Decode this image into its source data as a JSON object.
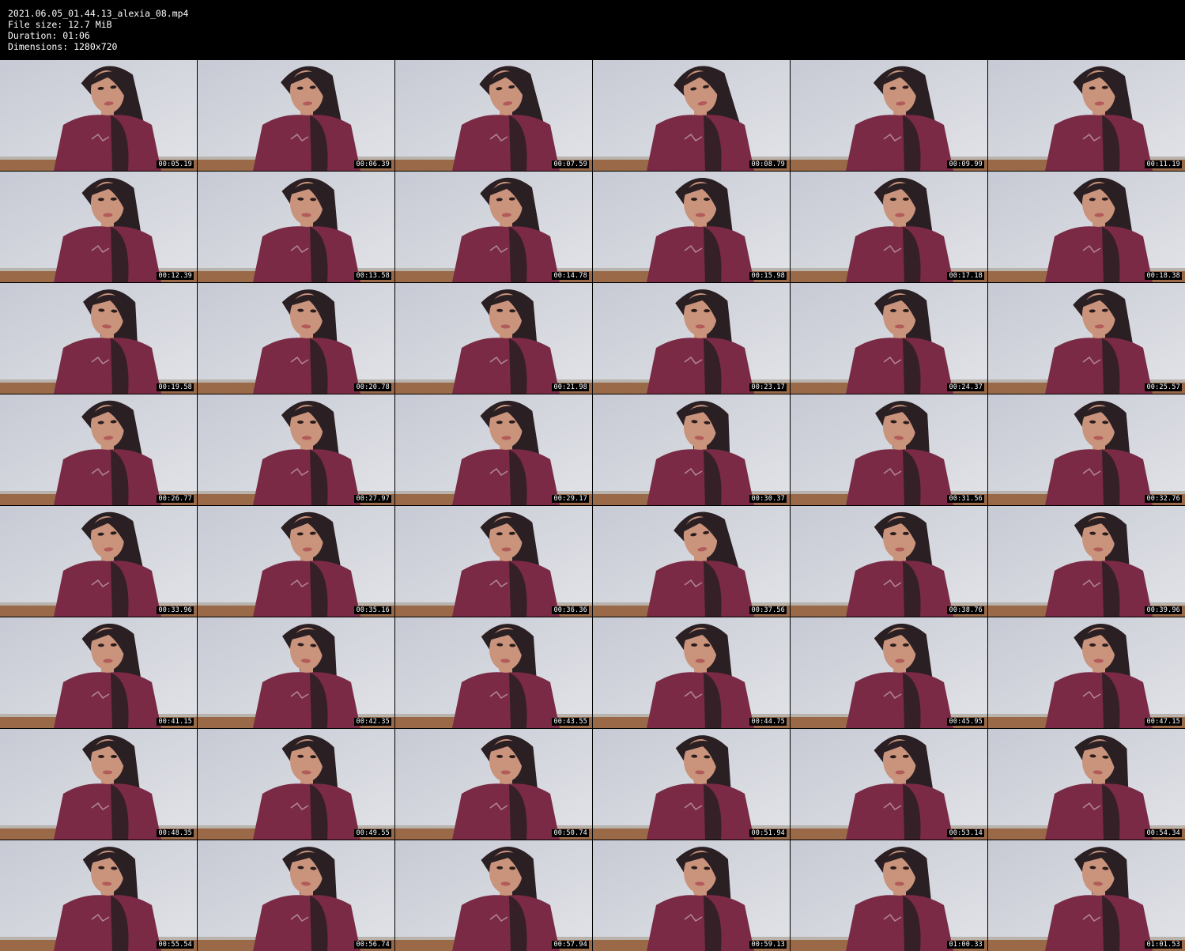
{
  "file_info": {
    "filename": "2021.06.05_01.44.13_alexia_08.mp4",
    "file_size": "File size: 12.7 MiB",
    "duration": "Duration: 01:06",
    "dimensions": "Dimensions: 1280x720"
  },
  "thumbnails": [
    {
      "timestamp": "00:05.19"
    },
    {
      "timestamp": "00:06.39"
    },
    {
      "timestamp": "00:07.59"
    },
    {
      "timestamp": "00:08.79"
    },
    {
      "timestamp": "00:09.99"
    },
    {
      "timestamp": "00:11.19"
    },
    {
      "timestamp": "00:12.39"
    },
    {
      "timestamp": "00:13.58"
    },
    {
      "timestamp": "00:14.78"
    },
    {
      "timestamp": "00:15.98"
    },
    {
      "timestamp": "00:17.18"
    },
    {
      "timestamp": "00:18.38"
    },
    {
      "timestamp": "00:19.58"
    },
    {
      "timestamp": "00:20.78"
    },
    {
      "timestamp": "00:21.98"
    },
    {
      "timestamp": "00:23.17"
    },
    {
      "timestamp": "00:24.37"
    },
    {
      "timestamp": "00:25.57"
    },
    {
      "timestamp": "00:26.77"
    },
    {
      "timestamp": "00:27.97"
    },
    {
      "timestamp": "00:29.17"
    },
    {
      "timestamp": "00:30.37"
    },
    {
      "timestamp": "00:31.56"
    },
    {
      "timestamp": "00:32.76"
    },
    {
      "timestamp": "00:33.96"
    },
    {
      "timestamp": "00:35.16"
    },
    {
      "timestamp": "00:36.36"
    },
    {
      "timestamp": "00:37.56"
    },
    {
      "timestamp": "00:38.76"
    },
    {
      "timestamp": "00:39.96"
    },
    {
      "timestamp": "00:41.15"
    },
    {
      "timestamp": "00:42.35"
    },
    {
      "timestamp": "00:43.55"
    },
    {
      "timestamp": "00:44.75"
    },
    {
      "timestamp": "00:45.95"
    },
    {
      "timestamp": "00:47.15"
    },
    {
      "timestamp": "00:48.35"
    },
    {
      "timestamp": "00:49.55"
    },
    {
      "timestamp": "00:50.74"
    },
    {
      "timestamp": "00:51.94"
    },
    {
      "timestamp": "00:53.14"
    },
    {
      "timestamp": "00:54.34"
    },
    {
      "timestamp": "00:55.54"
    },
    {
      "timestamp": "00:56.74"
    },
    {
      "timestamp": "00:57.94"
    },
    {
      "timestamp": "00:59.13"
    },
    {
      "timestamp": "01:00.33"
    },
    {
      "timestamp": "01:01.53"
    }
  ],
  "colors": {
    "background": "#000000",
    "wall": "#cfd2da",
    "shirt": "#7a2a44",
    "hair": "#2a1f22",
    "skin": "#c9937c",
    "floor": "#9a6a48"
  }
}
